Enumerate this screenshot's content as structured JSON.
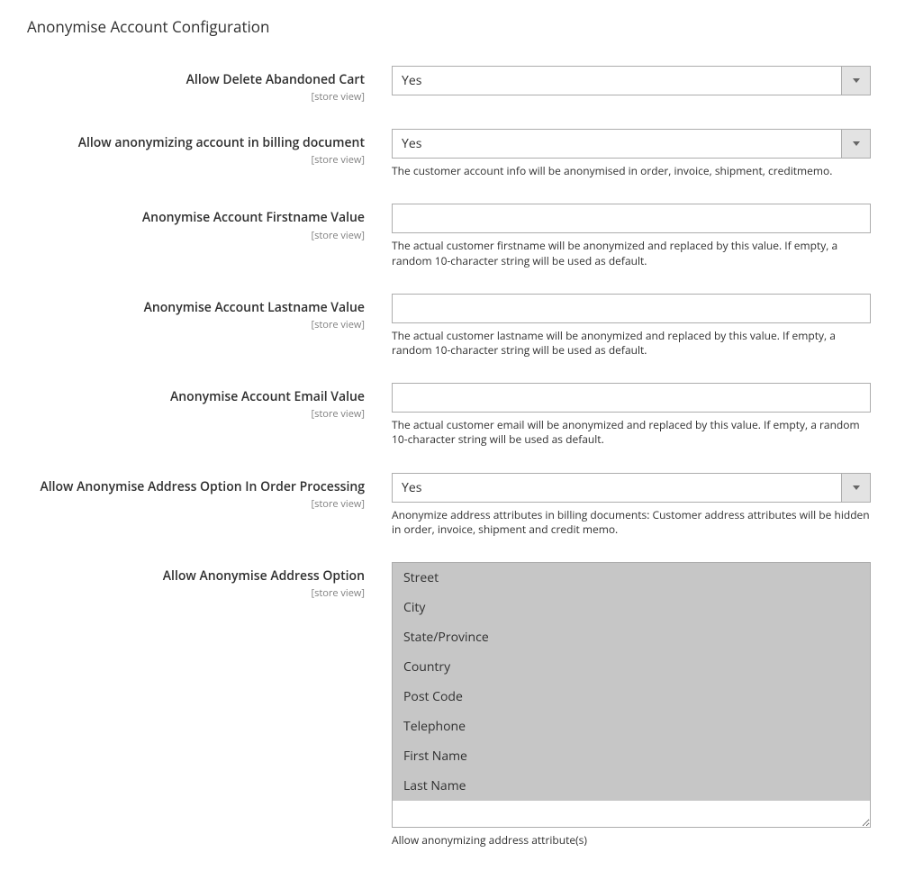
{
  "section": {
    "title": "Anonymise Account Configuration"
  },
  "scope": "[store view]",
  "fields": {
    "allow_delete_abandoned_cart": {
      "label": "Allow Delete Abandoned Cart",
      "value": "Yes"
    },
    "allow_anon_billing_doc": {
      "label": "Allow anonymizing account in billing document",
      "value": "Yes",
      "help": "The customer account info will be anonymised in order, invoice, shipment, creditmemo."
    },
    "anon_firstname": {
      "label": "Anonymise Account Firstname Value",
      "value": "",
      "help": "The actual customer firstname will be anonymized and replaced by this value. If empty, a random 10-character string will be used as default."
    },
    "anon_lastname": {
      "label": "Anonymise Account Lastname Value",
      "value": "",
      "help": "The actual customer lastname will be anonymized and replaced by this value. If empty, a random 10-character string will be used as default."
    },
    "anon_email": {
      "label": "Anonymise Account Email Value",
      "value": "",
      "help": "The actual customer email will be anonymized and replaced by this value. If empty, a random 10-character string will be used as default."
    },
    "allow_anon_address_order": {
      "label": "Allow Anonymise Address Option In Order Processing",
      "value": "Yes",
      "help": "Anonymize address attributes in billing documents: Customer address attributes will be hidden in order, invoice, shipment and credit memo."
    },
    "allow_anon_address_option": {
      "label": "Allow Anonymise Address Option",
      "help": "Allow anonymizing address attribute(s)",
      "options": [
        {
          "label": "Street",
          "selected": true
        },
        {
          "label": "City",
          "selected": true
        },
        {
          "label": "State/Province",
          "selected": true
        },
        {
          "label": "Country",
          "selected": true
        },
        {
          "label": "Post Code",
          "selected": true
        },
        {
          "label": "Telephone",
          "selected": true
        },
        {
          "label": "First Name",
          "selected": true
        },
        {
          "label": "Last Name",
          "selected": true
        }
      ]
    }
  }
}
